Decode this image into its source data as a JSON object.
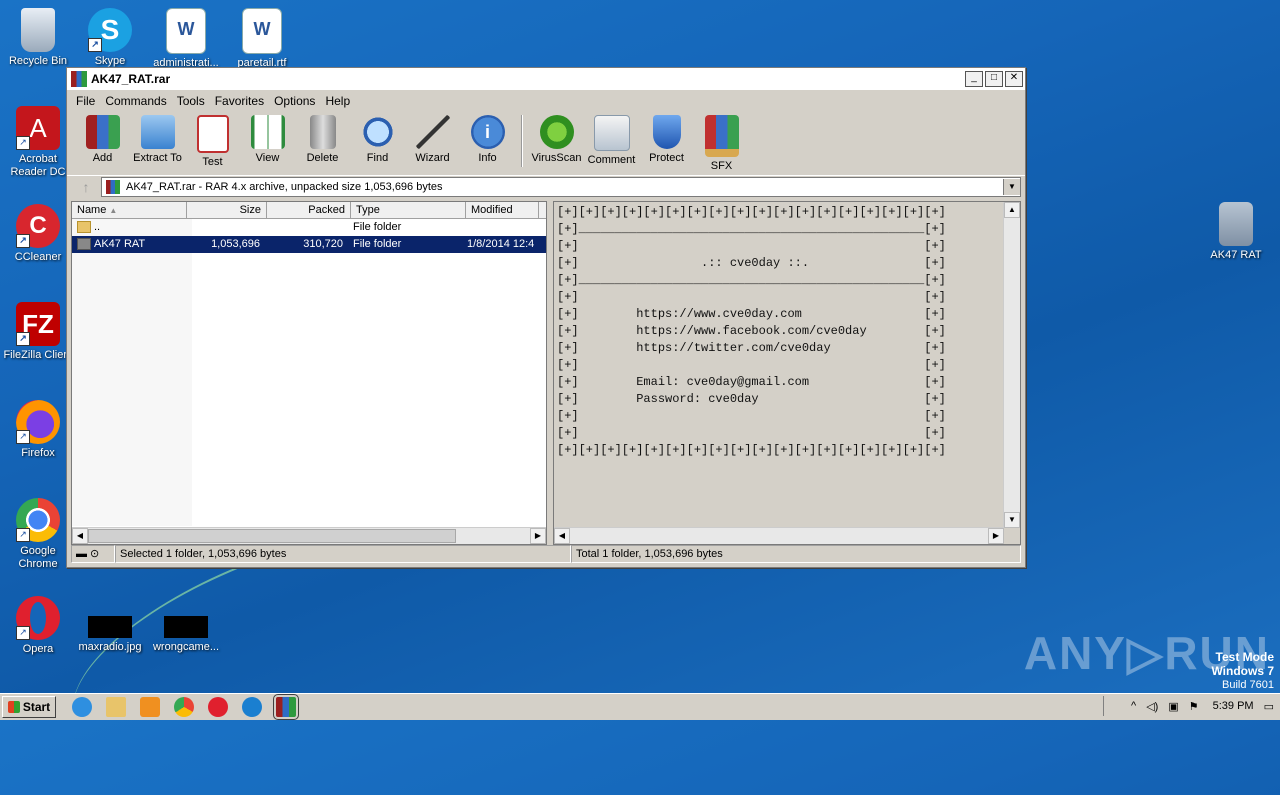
{
  "desktop": {
    "icons": [
      {
        "label": "Recycle Bin"
      },
      {
        "label": "Skype"
      },
      {
        "label": "administrati..."
      },
      {
        "label": "paretail.rtf"
      },
      {
        "label": "Acrobat Reader DC"
      },
      {
        "label": "CCleaner"
      },
      {
        "label": "FileZilla Client"
      },
      {
        "label": "Firefox"
      },
      {
        "label": "Google Chrome"
      },
      {
        "label": "Opera"
      },
      {
        "label": "maxradio.jpg"
      },
      {
        "label": "wrongcame..."
      },
      {
        "label": "AK47 RAT"
      }
    ],
    "watermark": "ANY▷RUN",
    "testmode": {
      "line1": "Test Mode",
      "line2": "Windows 7",
      "line3": "Build 7601"
    }
  },
  "window": {
    "title": "AK47_RAT.rar",
    "menu": [
      "File",
      "Commands",
      "Tools",
      "Favorites",
      "Options",
      "Help"
    ],
    "toolbar": [
      "Add",
      "Extract To",
      "Test",
      "View",
      "Delete",
      "Find",
      "Wizard",
      "Info",
      "VirusScan",
      "Comment",
      "Protect",
      "SFX"
    ],
    "path": "AK47_RAT.rar - RAR 4.x archive, unpacked size 1,053,696 bytes",
    "columns": [
      "Name",
      "Size",
      "Packed",
      "Type",
      "Modified"
    ],
    "rows": [
      {
        "name": "..",
        "size": "",
        "packed": "",
        "type": "File folder",
        "modified": ""
      },
      {
        "name": "AK47 RAT",
        "size": "1,053,696",
        "packed": "310,720",
        "type": "File folder",
        "modified": "1/8/2014 12:4"
      }
    ],
    "comment": "[+][+][+][+][+][+][+][+][+][+][+][+][+][+][+][+][+][+]\n[+]________________________________________________[+]\n[+]                                                [+]\n[+]                 .:: cve0day ::.                [+]\n[+]________________________________________________[+]\n[+]                                                [+]\n[+]        https://www.cve0day.com                 [+]\n[+]        https://www.facebook.com/cve0day        [+]\n[+]        https://twitter.com/cve0day             [+]\n[+]                                                [+]\n[+]        Email: cve0day@gmail.com                [+]\n[+]        Password: cve0day                       [+]\n[+]                                                [+]\n[+]                                                [+]\n[+][+][+][+][+][+][+][+][+][+][+][+][+][+][+][+][+][+]",
    "status_left": "Selected 1 folder, 1,053,696 bytes",
    "status_right": "Total 1 folder, 1,053,696 bytes"
  },
  "taskbar": {
    "start": "Start",
    "clock": "5:39 PM"
  }
}
